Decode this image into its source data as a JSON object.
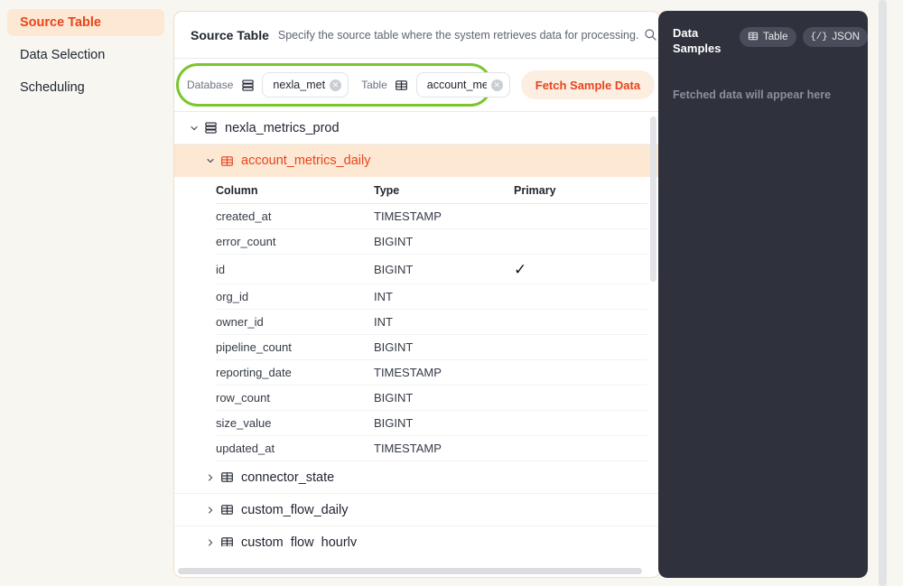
{
  "sidebar": {
    "items": [
      {
        "label": "Source Table",
        "active": true
      },
      {
        "label": "Data Selection",
        "active": false
      },
      {
        "label": "Scheduling",
        "active": false
      }
    ]
  },
  "card": {
    "title": "Source Table",
    "subtitle": "Specify the source table where the system retrieves data for processing.",
    "search_icon": "search-icon"
  },
  "toolbar": {
    "database_label": "Database",
    "database_icon": "database-icon",
    "database_chip": "nexla_met",
    "table_label": "Table",
    "table_icon": "table-icon",
    "table_chip": "account_metri",
    "remove_icon": "close-icon",
    "fetch_label": "Fetch Sample Data",
    "refresh_icon": "refresh-icon",
    "highlight_color": "#79c62e",
    "fetch_color": "#e8441b"
  },
  "tree": {
    "database": {
      "label": "nexla_metrics_prod",
      "icon": "database-icon",
      "caret": "chevron-down-icon",
      "expanded": true
    },
    "selected_table": {
      "label": "account_metrics_daily",
      "icon": "table-icon",
      "caret": "chevron-down-icon",
      "expanded": true,
      "highlight_color": "#fde8d3",
      "text_color": "#e8441b"
    },
    "columns_header": {
      "column": "Column",
      "type": "Type",
      "primary": "Primary"
    },
    "columns": [
      {
        "name": "created_at",
        "type": "TIMESTAMP",
        "primary": ""
      },
      {
        "name": "error_count",
        "type": "BIGINT",
        "primary": ""
      },
      {
        "name": "id",
        "type": "BIGINT",
        "primary": "✓"
      },
      {
        "name": "org_id",
        "type": "INT",
        "primary": ""
      },
      {
        "name": "owner_id",
        "type": "INT",
        "primary": ""
      },
      {
        "name": "pipeline_count",
        "type": "BIGINT",
        "primary": ""
      },
      {
        "name": "reporting_date",
        "type": "TIMESTAMP",
        "primary": ""
      },
      {
        "name": "row_count",
        "type": "BIGINT",
        "primary": ""
      },
      {
        "name": "size_value",
        "type": "BIGINT",
        "primary": ""
      },
      {
        "name": "updated_at",
        "type": "TIMESTAMP",
        "primary": ""
      }
    ],
    "collapsed_tables": [
      {
        "label": "connector_state",
        "icon": "table-icon",
        "caret": "chevron-right-icon"
      },
      {
        "label": "custom_flow_daily",
        "icon": "table-icon",
        "caret": "chevron-right-icon"
      },
      {
        "label": "custom_flow_hourly",
        "icon": "table-icon",
        "caret": "chevron-right-icon"
      }
    ]
  },
  "samples": {
    "title": "Data Samples",
    "title_line1": "Data",
    "title_line2": "Samples",
    "view_table": "Table",
    "view_json": "JSON",
    "json_glyph": "{/}",
    "table_icon": "table-icon",
    "empty_text": "Fetched data will appear here",
    "background": "#2f313c"
  }
}
